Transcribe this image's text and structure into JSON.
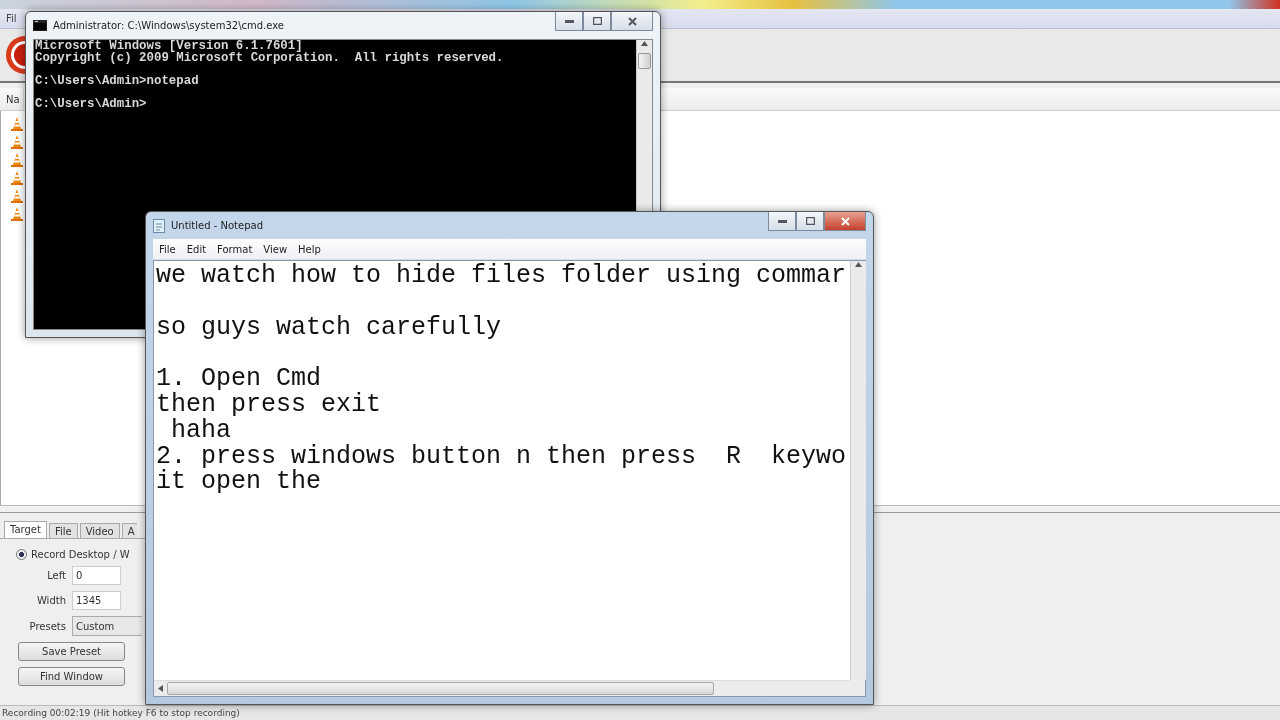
{
  "background_app": {
    "menu": [
      "Fil"
    ],
    "list_header": "Na",
    "tabs": [
      {
        "label": "Target",
        "selected": true
      },
      {
        "label": "File",
        "selected": false
      },
      {
        "label": "Video",
        "selected": false
      },
      {
        "label": "A",
        "selected": false
      }
    ],
    "record_option": {
      "label": "Record Desktop / W",
      "selected": true
    },
    "fields": [
      {
        "label": "Left",
        "value": "0"
      },
      {
        "label": "Width",
        "value": "1345"
      }
    ],
    "presets": {
      "label": "Presets",
      "value": "Custom"
    },
    "buttons": [
      "Save Preset",
      "Find Window"
    ],
    "status_bar": "Recording 00:02:19 (Hit hotkey F6 to stop recording)"
  },
  "cmd_window": {
    "title": "Administrator: C:\\Windows\\system32\\cmd.exe",
    "output": "Microsoft Windows [Version 6.1.7601]\nCopyright (c) 2009 Microsoft Corporation.  All rights reserved.\n\nC:\\Users\\Admin>notepad\n\nC:\\Users\\Admin>"
  },
  "notepad_window": {
    "title": "Untitled - Notepad",
    "menu": [
      "File",
      "Edit",
      "Format",
      "View",
      "Help"
    ],
    "text": "we watch how to hide files folder using commar\n\nso guys watch carefully\n\n1. Open Cmd\nthen press exit\n haha\n2. press windows button n then press  R  keywo\nit open the "
  }
}
